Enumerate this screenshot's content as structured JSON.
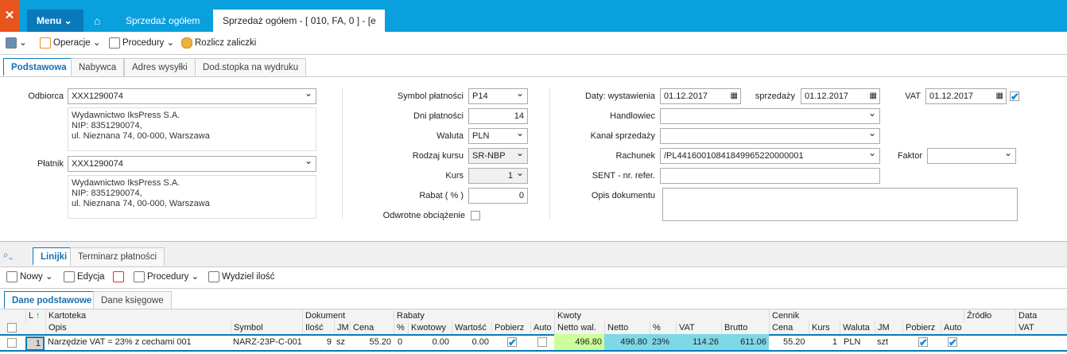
{
  "header": {
    "menu": "Menu",
    "tabs": [
      "Sprzedaż ogółem",
      "Sprzedaż ogółem - [ 010, FA, 0 ] - [e"
    ]
  },
  "toolbar": {
    "operacje": "Operacje",
    "procedury": "Procedury",
    "rozlicz": "Rozlicz zaliczki"
  },
  "form_tabs": [
    "Podstawowa",
    "Nabywca",
    "Adres wysyłki",
    "Dod.stopka na wydruku"
  ],
  "form": {
    "odbiorca_label": "Odbiorca",
    "odbiorca": "XXX1290074",
    "odbiorca_addr": [
      "Wydawnictwo IksPress S.A.",
      "NIP: 8351290074,",
      "ul. Nieznana 74, 00-000, Warszawa"
    ],
    "platnik_label": "Płatnik",
    "platnik": "XXX1290074",
    "platnik_addr": [
      "Wydawnictwo IksPress S.A.",
      "NIP: 8351290074,",
      "ul. Nieznana 74, 00-000, Warszawa"
    ],
    "symbol_label": "Symbol płatności",
    "symbol": "P14",
    "dni_label": "Dni płatności",
    "dni": "14",
    "waluta_label": "Waluta",
    "waluta": "PLN",
    "rodzaj_label": "Rodzaj kursu",
    "rodzaj": "SR-NBP",
    "kurs_label": "Kurs",
    "kurs": "1",
    "rabat_label": "Rabat ( % )",
    "rabat": "0",
    "odwrotne_label": "Odwrotne obciążenie",
    "daty_label": "Daty: wystawienia",
    "wystawienia": "01.12.2017",
    "sprzedazy_label": "sprzedaży",
    "sprzedazy": "01.12.2017",
    "vat_label": "VAT",
    "vat": "01.12.2017",
    "handlowiec_label": "Handlowiec",
    "kanal_label": "Kanał sprzedaży",
    "rachunek_label": "Rachunek",
    "rachunek": "/PL44160010841849965220000001",
    "faktor_label": "Faktor",
    "sent_label": "SENT - nr. refer.",
    "opis_label": "Opis dokumentu"
  },
  "lower_tabs": [
    "Linijki",
    "Terminarz płatności"
  ],
  "lower_toolbar": {
    "nowy": "Nowy",
    "edycja": "Edycja",
    "procedury": "Procedury",
    "wydziel": "Wydziel ilość"
  },
  "grid_tabs": [
    "Dane podstawowe",
    "Dane księgowe"
  ],
  "grid": {
    "groups": {
      "l": "L",
      "kartoteka": "Kartoteka",
      "dokument": "Dokument",
      "rabaty": "Rabaty",
      "kwoty": "Kwoty",
      "cennik": "Cennik",
      "zrodlo": "Źródło",
      "data": "Data"
    },
    "columns": [
      "Opis",
      "Symbol",
      "Ilość",
      "JM",
      "Cena",
      "%",
      "Kwotowy",
      "Wartość",
      "Pobierz",
      "Auto",
      "Netto wal.",
      "Netto",
      "%",
      "VAT",
      "Brutto",
      "Cena",
      "Kurs",
      "Waluta",
      "JM",
      "Pobierz",
      "Auto",
      "VAT"
    ],
    "row": {
      "lp": "1",
      "opis": "Narzędzie VAT = 23% z cechami 001",
      "symbol": "NARZ-23P-C-001",
      "ilosc": "9",
      "jm": "sz",
      "cena": "55.20",
      "proc": "0",
      "kwotowy": "0.00",
      "wartosc": "0.00",
      "pobierz": true,
      "auto": false,
      "netto_wal": "496.80",
      "netto": "496.80",
      "vat_proc": "23%",
      "vat": "114.26",
      "brutto": "611.06",
      "c_cena": "55.20",
      "c_kurs": "1",
      "c_waluta": "PLN",
      "c_jm": "szt",
      "c_pobierz": true,
      "c_auto": true
    }
  },
  "colors": {
    "accent": "#0a9fdd",
    "logo": "#e8541e",
    "netto_wal_bg": "#ccff99",
    "kwoty_bg": "#7fd8e6"
  }
}
